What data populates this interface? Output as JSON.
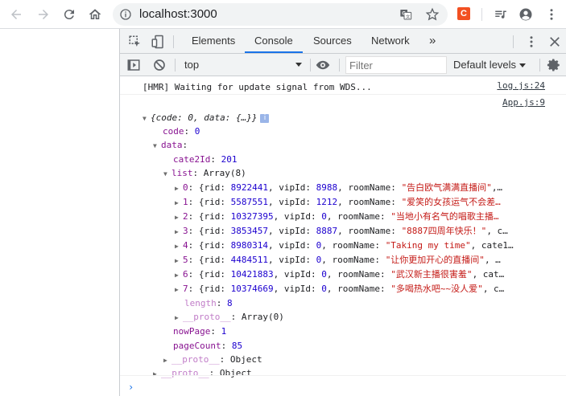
{
  "browser": {
    "url": "localhost:3000",
    "icons": [
      "back-arrow-icon",
      "forward-arrow-icon",
      "reload-icon",
      "home-icon",
      "info-icon",
      "translate-icon",
      "star-icon",
      "extension-c-icon",
      "media-queue-icon",
      "profile-icon",
      "more-vert-icon"
    ],
    "extension_label": "C"
  },
  "devtools": {
    "tabs": [
      "Elements",
      "Console",
      "Sources",
      "Network"
    ],
    "active_tab": "Console",
    "more_tabs": "»",
    "context": "top",
    "filter_placeholder": "Filter",
    "levels_label": "Default levels",
    "accent": "#1a73e8"
  },
  "console": {
    "hmr": {
      "text": "[HMR] Waiting for update signal from WDS...",
      "source": "log.js:24"
    },
    "app_source": "App.js:9",
    "summary": "{code: 0, data: {…}}",
    "info_badge": "i",
    "code": {
      "key": "code",
      "value": "0"
    },
    "data_key": "data",
    "cate2Id": {
      "key": "cate2Id",
      "value": "201"
    },
    "list": {
      "key": "list",
      "value": "Array(8)"
    },
    "items": [
      {
        "idx": "0",
        "rid": "8922441",
        "vipId": "8988",
        "roomName": "\"告白欧气满满直播间\"",
        "tail": ",…"
      },
      {
        "idx": "1",
        "rid": "5587551",
        "vipId": "1212",
        "roomName": "\"爱笑的女孩运气不会差…",
        "tail": ""
      },
      {
        "idx": "2",
        "rid": "10327395",
        "vipId": "0",
        "roomName": "\"当地小有名气的唱歌主播…",
        "tail": ""
      },
      {
        "idx": "3",
        "rid": "3853457",
        "vipId": "8887",
        "roomName": "\"8887四周年快乐！\"",
        "tail": ", c…"
      },
      {
        "idx": "4",
        "rid": "8980314",
        "vipId": "0",
        "roomName": "\"Taking my time\"",
        "tail": ", cate1…"
      },
      {
        "idx": "5",
        "rid": "4484511",
        "vipId": "0",
        "roomName": "\"让你更加开心的直播间\"",
        "tail": ", …"
      },
      {
        "idx": "6",
        "rid": "10421883",
        "vipId": "0",
        "roomName": "\"武汉新主播很害羞\"",
        "tail": ", cat…"
      },
      {
        "idx": "7",
        "rid": "10374669",
        "vipId": "0",
        "roomName": "\"多喝热水吧~~没人爱\"",
        "tail": ", c…"
      }
    ],
    "length": {
      "key": "length",
      "value": "8"
    },
    "list_proto": {
      "key": "__proto__",
      "value": "Array(0)"
    },
    "nowPage": {
      "key": "nowPage",
      "value": "1"
    },
    "pageCount": {
      "key": "pageCount",
      "value": "85"
    },
    "data_proto": {
      "key": "__proto__",
      "value": "Object"
    },
    "root_proto": {
      "key": "__proto__",
      "value": "Object"
    },
    "prompt": "›"
  }
}
